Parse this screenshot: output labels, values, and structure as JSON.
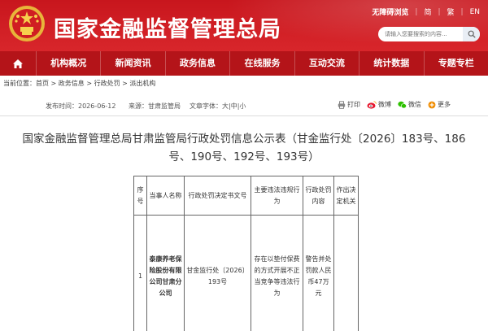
{
  "header": {
    "site_title": "国家金融监督管理总局",
    "accessibility": "无障碍浏览",
    "lang_simplified": "简",
    "lang_traditional": "繁",
    "lang_english": "EN",
    "search_placeholder": "请输入您要搜索的内容...",
    "brand_color": "#c8161d"
  },
  "nav": {
    "items": [
      "机构概况",
      "新闻资讯",
      "政务信息",
      "在线服务",
      "互动交流",
      "统计数据",
      "专题专栏"
    ]
  },
  "breadcrumb": {
    "prefix": "当前位置：",
    "path": [
      "首页",
      "政务信息",
      "行政处罚",
      "派出机构"
    ]
  },
  "meta": {
    "publish_time": "发布时间：2026-06-12",
    "source": "来源：甘肃监管局",
    "font_size": "文章字体：",
    "font_sizes": [
      "大",
      "中",
      "小"
    ],
    "print": "打印",
    "weibo": "微博",
    "wechat": "微信",
    "more": "更多"
  },
  "article": {
    "title": "国家金融监督管理总局甘肃监管局行政处罚信息公示表（甘金监行处〔2026〕183号、186号、190号、192号、193号）"
  },
  "table": {
    "headers": [
      "序号",
      "当事人名称",
      "行政处罚决定书文号",
      "主要违法违规行为",
      "行政处罚内容",
      "作出决定机关"
    ],
    "rows": [
      {
        "index": "1",
        "party": "泰康养老保险股份有限公司甘肃分公司",
        "doc_no": "甘金监行处〔2026〕193号",
        "violation": "存在以垫付保费的方式开展不正当竞争等违法行为",
        "penalty": "警告并处罚款人民币47万元",
        "authority": ""
      }
    ]
  }
}
